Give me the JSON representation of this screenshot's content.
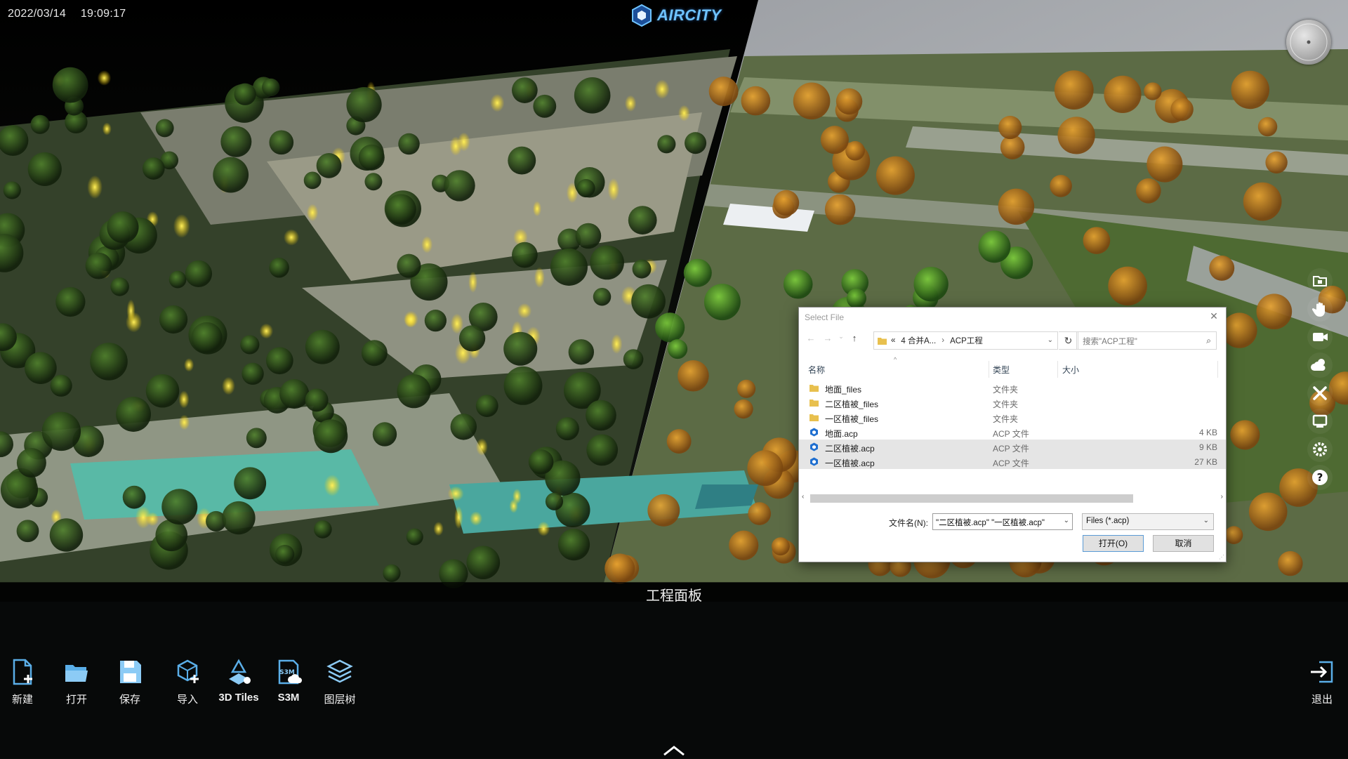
{
  "status": {
    "date": "2022/03/14",
    "time": "19:09:17"
  },
  "brand": {
    "name": "AIRCITY",
    "color": "#6fc3ff"
  },
  "right_toolbar": [
    {
      "icon": "folder-icon"
    },
    {
      "icon": "hand-icon"
    },
    {
      "icon": "camera-icon"
    },
    {
      "icon": "weather-icon"
    },
    {
      "icon": "tools-icon"
    },
    {
      "icon": "monitor-icon"
    },
    {
      "icon": "settings-icon"
    },
    {
      "icon": "help-icon"
    }
  ],
  "dialog": {
    "title": "Select File",
    "breadcrumb": [
      "«",
      "4 合并A...",
      "ACP工程"
    ],
    "search_placeholder": "搜索\"ACP工程\"",
    "columns": {
      "name": "名称",
      "type": "类型",
      "size": "大小"
    },
    "files": [
      {
        "name": "地面_files",
        "type": "文件夹",
        "size": "",
        "kind": "folder",
        "selected": false
      },
      {
        "name": "二区植被_files",
        "type": "文件夹",
        "size": "",
        "kind": "folder",
        "selected": false
      },
      {
        "name": "一区植被_files",
        "type": "文件夹",
        "size": "",
        "kind": "folder",
        "selected": false
      },
      {
        "name": "地面.acp",
        "type": "ACP 文件",
        "size": "4 KB",
        "kind": "acp",
        "selected": false
      },
      {
        "name": "二区植被.acp",
        "type": "ACP 文件",
        "size": "9 KB",
        "kind": "acp",
        "selected": true
      },
      {
        "name": "一区植被.acp",
        "type": "ACP 文件",
        "size": "27 KB",
        "kind": "acp",
        "selected": true
      }
    ],
    "filename_label": "文件名(N):",
    "filename_value": "\"二区植被.acp\" \"一区植被.acp\"",
    "filter_value": "Files (*.acp)",
    "open_label": "打开(O)",
    "cancel_label": "取消"
  },
  "panel": {
    "title": "工程面板",
    "tools": [
      {
        "label": "新建",
        "icon": "new-file-icon"
      },
      {
        "label": "打开",
        "icon": "open-folder-icon"
      },
      {
        "label": "保存",
        "icon": "save-icon"
      },
      {
        "label": "导入",
        "icon": "import-icon"
      },
      {
        "label": "3D Tiles",
        "icon": "3d-tiles-icon"
      },
      {
        "label": "S3M",
        "icon": "s3m-icon"
      },
      {
        "label": "图层树",
        "icon": "layer-tree-icon"
      }
    ],
    "exit_label": "退出"
  }
}
